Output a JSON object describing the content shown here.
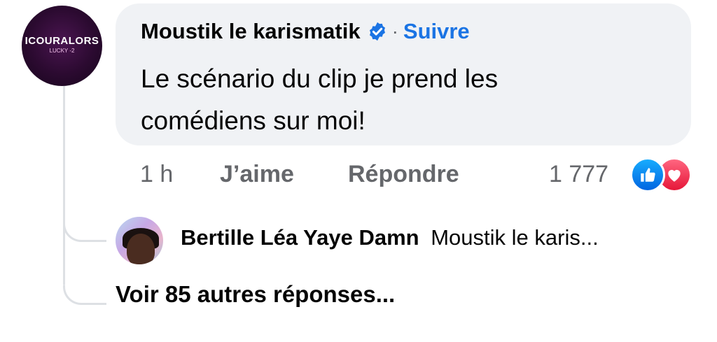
{
  "comment": {
    "author": "Moustik le karismatik",
    "separator": "·",
    "follow_label": "Suivre",
    "text_line1": "Le scénario du clip je prend les",
    "text_line2": "comédiens sur moi!",
    "time": "1 h",
    "like_label": "J’aime",
    "reply_label": "Répondre",
    "reaction_count": "1 777",
    "reactions": [
      "like-icon",
      "love-icon"
    ],
    "avatar": {
      "logo_text": "ICOURALORS",
      "sub_text": "LUCKY -2"
    }
  },
  "reply_preview": {
    "author": "Bertille Léa Yaye Damn",
    "text": "Moustik le karis..."
  },
  "more_replies_label": "Voir 85 autres réponses...",
  "colors": {
    "link_blue": "#1b74e4",
    "bubble_bg": "#f0f2f5",
    "meta_gray": "#65676b",
    "like_blue": "#0a7cff",
    "love_red": "#f0284a"
  }
}
